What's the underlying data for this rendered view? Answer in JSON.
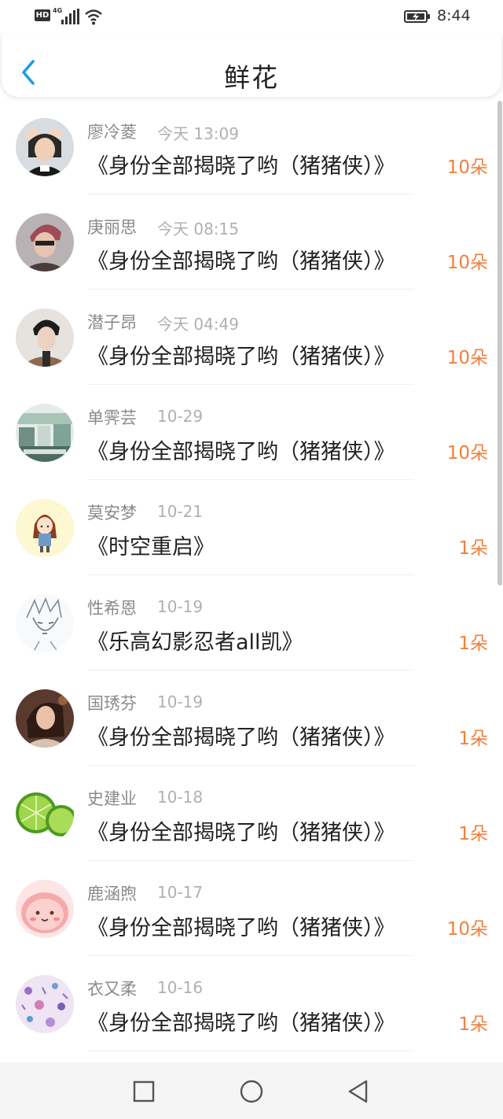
{
  "status_bar": {
    "hd": "HD",
    "network": "4G",
    "time": "8:44"
  },
  "header": {
    "title": "鲜花",
    "back_icon": "chevron-left-icon",
    "accent_color": "#1e9ce8"
  },
  "list": {
    "count_color": "#f07f3c",
    "items": [
      {
        "name": "廖冷菱",
        "time": "今天 13:09",
        "book": "《身份全部揭晓了哟（猪猪侠）》",
        "count": "10朵"
      },
      {
        "name": "庚丽思",
        "time": "今天 08:15",
        "book": "《身份全部揭晓了哟（猪猪侠）》",
        "count": "10朵"
      },
      {
        "name": "潜子昂",
        "time": "今天 04:49",
        "book": "《身份全部揭晓了哟（猪猪侠）》",
        "count": "10朵"
      },
      {
        "name": "单霁芸",
        "time": "10-29",
        "book": "《身份全部揭晓了哟（猪猪侠）》",
        "count": "10朵"
      },
      {
        "name": "莫安梦",
        "time": "10-21",
        "book": "《时空重启》",
        "count": "1朵"
      },
      {
        "name": "性希恩",
        "time": "10-19",
        "book": "《乐高幻影忍者all凯》",
        "count": "1朵"
      },
      {
        "name": "国琇芬",
        "time": "10-19",
        "book": "《身份全部揭晓了哟（猪猪侠）》",
        "count": "1朵"
      },
      {
        "name": "史建业",
        "time": "10-18",
        "book": "《身份全部揭晓了哟（猪猪侠）》",
        "count": "1朵"
      },
      {
        "name": "鹿涵煦",
        "time": "10-17",
        "book": "《身份全部揭晓了哟（猪猪侠）》",
        "count": "10朵"
      },
      {
        "name": "衣又柔",
        "time": "10-16",
        "book": "《身份全部揭晓了哟（猪猪侠）》",
        "count": "1朵"
      }
    ]
  },
  "system_nav": {
    "recent_icon": "square-icon",
    "home_icon": "circle-icon",
    "back_icon": "triangle-back-icon"
  }
}
